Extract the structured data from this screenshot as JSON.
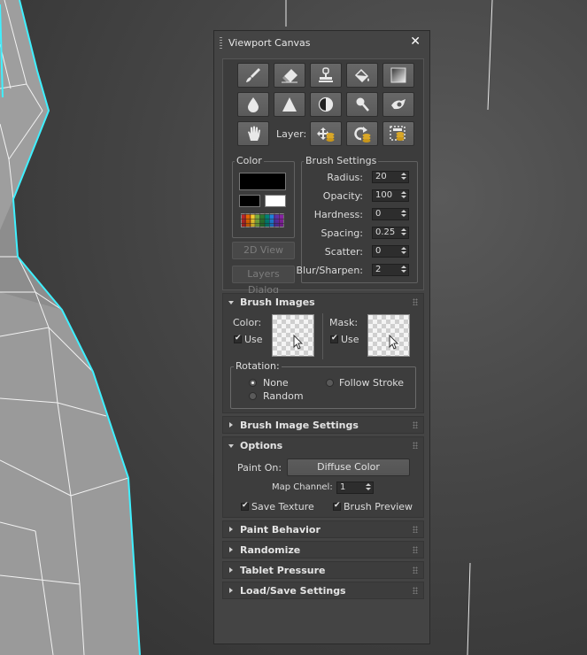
{
  "window": {
    "title": "Viewport Canvas",
    "close_glyph": "✕"
  },
  "toolbar": {
    "row1": [
      "paint-brush-icon",
      "eraser-icon",
      "clone-stamp-icon",
      "fill-bucket-icon",
      "gradient-icon"
    ],
    "row2": [
      "blur-drop-icon",
      "sharpen-triangle-icon",
      "contrast-icon",
      "smudge-icon",
      "burn-dodge-icon"
    ],
    "row3": [
      "hand-pan-icon"
    ],
    "layer_label": "Layer:",
    "layer_icons": [
      "layer-move-icon",
      "layer-rotate-icon",
      "layer-scale-icon"
    ]
  },
  "color_group": {
    "title": "Color",
    "primary": "#000000",
    "secondary_left": "#000000",
    "secondary_right": "#ffffff"
  },
  "view_buttons": {
    "view2d": "2D View",
    "layers_dialog": "Layers Dialog"
  },
  "brush_settings": {
    "title": "Brush Settings",
    "fields": [
      {
        "label": "Radius:",
        "value": "20"
      },
      {
        "label": "Opacity:",
        "value": "100"
      },
      {
        "label": "Hardness:",
        "value": "0"
      },
      {
        "label": "Spacing:",
        "value": "0.25"
      },
      {
        "label": "Scatter:",
        "value": "0"
      },
      {
        "label": "Blur/Sharpen:",
        "value": "2"
      }
    ]
  },
  "brush_images": {
    "title": "Brush Images",
    "color_label": "Color:",
    "color_use": "Use",
    "mask_label": "Mask:",
    "mask_use": "Use",
    "rotation_title": "Rotation:",
    "rotation_none": "None",
    "rotation_follow": "Follow Stroke",
    "rotation_random": "Random"
  },
  "brush_image_settings": {
    "title": "Brush Image Settings"
  },
  "options": {
    "title": "Options",
    "paint_on_label": "Paint On:",
    "paint_on_value": "Diffuse Color",
    "map_channel_label": "Map Channel:",
    "map_channel_value": "1",
    "save_texture": "Save Texture",
    "brush_preview": "Brush Preview"
  },
  "collapsed_rollouts": {
    "paint_behavior": "Paint Behavior",
    "randomize": "Randomize",
    "tablet_pressure": "Tablet Pressure",
    "load_save": "Load/Save Settings"
  },
  "colors": {
    "accent_cyan": "#3ff0ff",
    "panel_bg": "#444444",
    "rollout_bg": "#3d3d3d"
  }
}
